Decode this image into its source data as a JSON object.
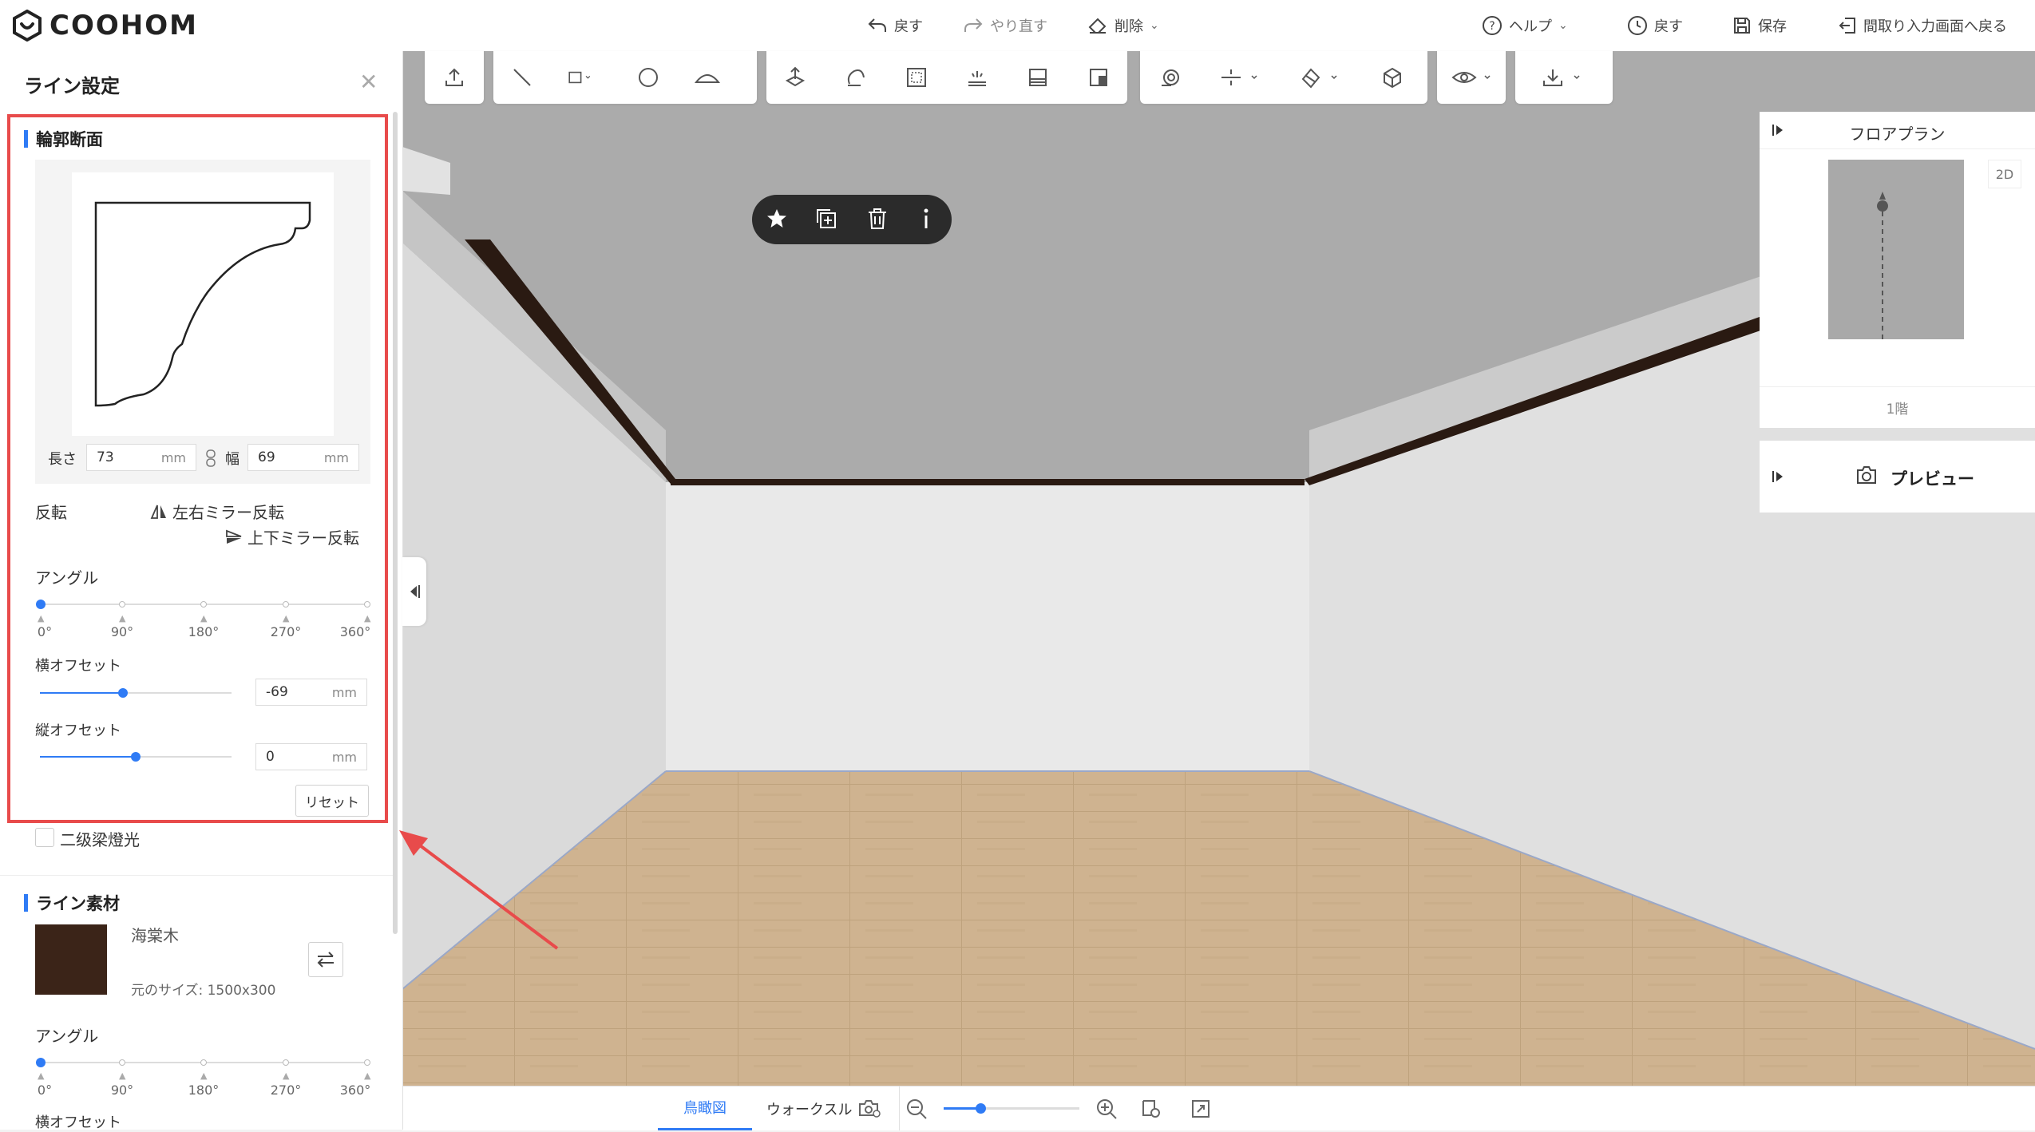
{
  "app": {
    "logo_text": "COOHOM"
  },
  "topbar": {
    "undo": "戻す",
    "redo": "やり直す",
    "delete": "削除",
    "help": "ヘルプ",
    "history": "戻す",
    "save": "保存",
    "back_to_floorplan": "間取り入力画面へ戻る"
  },
  "panel": {
    "title": "ライン設定",
    "profile_section": "輪郭断面",
    "length_label": "長さ",
    "length_value": "73",
    "width_label": "幅",
    "width_value": "69",
    "unit": "mm",
    "flip_label": "反転",
    "flip_lr": "左右ミラー反転",
    "flip_ud": "上下ミラー反転",
    "angle_label": "アングル",
    "angle_ticks": [
      "0°",
      "90°",
      "180°",
      "270°",
      "360°"
    ],
    "h_offset_label": "横オフセット",
    "h_offset_value": "-69",
    "v_offset_label": "縦オフセット",
    "v_offset_value": "0",
    "reset": "リセット",
    "secondary_beam": "二级梁燈光",
    "material_section": "ライン素材",
    "material_name": "海棠木",
    "material_size": "元のサイズ: 1500x300",
    "material_angle_label": "アングル",
    "material_h_offset_label": "横オフセット"
  },
  "floorplan": {
    "title": "フロアプラン",
    "mode": "2D",
    "level": "1階"
  },
  "preview": {
    "label": "プレビュー"
  },
  "bottombar": {
    "view_birdseye": "鳥瞰図",
    "view_walkthrough": "ウォークスル"
  },
  "colors": {
    "accent": "#2f7bf5",
    "highlight": "#e84b4b",
    "material_swatch": "#3b2418"
  },
  "icons": {
    "toolbar": [
      "export-icon",
      "line-icon",
      "rectangle-icon",
      "circle-icon",
      "arc-icon",
      "extrude-icon",
      "rotate-icon",
      "frame-icon",
      "light-strip-icon",
      "panel-icon",
      "split-icon",
      "spiral-icon",
      "align-icon",
      "paint-icon",
      "cube-icon",
      "eye-icon",
      "download-icon"
    ]
  }
}
